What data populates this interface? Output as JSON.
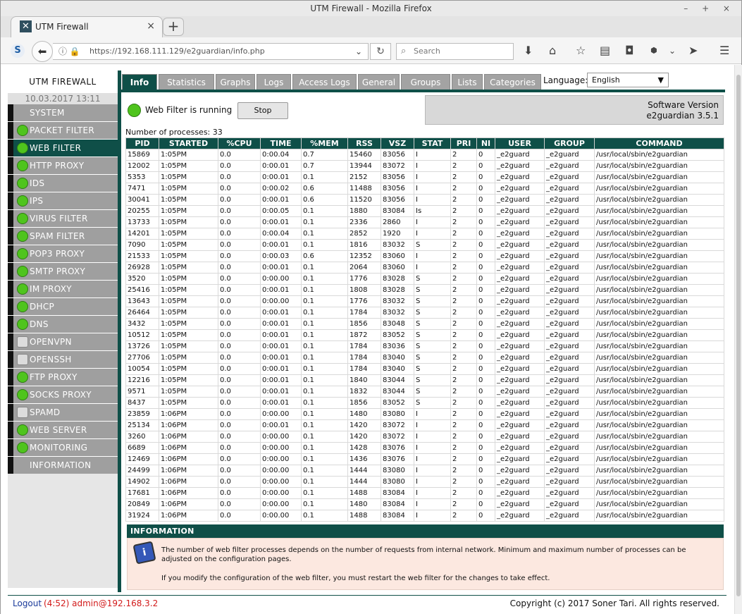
{
  "window": {
    "title": "UTM Firewall - Mozilla Firefox",
    "controls": "– + ×"
  },
  "tab": {
    "title": "UTM Firewall",
    "close": "×",
    "new_tab": "+"
  },
  "navbar": {
    "url": "https://192.168.111.129/e2guardian/info.php",
    "search_placeholder": "Search",
    "sync_badge": "S"
  },
  "sidebar": {
    "brand": "UTM FIREWALL",
    "datetime": "10.03.2017 13:11",
    "items": [
      {
        "label": "SYSTEM",
        "status": "none"
      },
      {
        "label": "PACKET FILTER",
        "status": "on"
      },
      {
        "label": "WEB FILTER",
        "status": "on",
        "active": true
      },
      {
        "label": "HTTP PROXY",
        "status": "on"
      },
      {
        "label": "IDS",
        "status": "on"
      },
      {
        "label": "IPS",
        "status": "on"
      },
      {
        "label": "VIRUS FILTER",
        "status": "on"
      },
      {
        "label": "SPAM FILTER",
        "status": "on"
      },
      {
        "label": "POP3 PROXY",
        "status": "on"
      },
      {
        "label": "SMTP PROXY",
        "status": "on"
      },
      {
        "label": "IM PROXY",
        "status": "on"
      },
      {
        "label": "DHCP",
        "status": "on"
      },
      {
        "label": "DNS",
        "status": "on"
      },
      {
        "label": "OPENVPN",
        "status": "off"
      },
      {
        "label": "OPENSSH",
        "status": "off"
      },
      {
        "label": "FTP PROXY",
        "status": "on"
      },
      {
        "label": "SOCKS PROXY",
        "status": "on"
      },
      {
        "label": "SPAMD",
        "status": "off"
      },
      {
        "label": "WEB SERVER",
        "status": "on"
      },
      {
        "label": "MONITORING",
        "status": "on"
      },
      {
        "label": "INFORMATION",
        "status": "none"
      }
    ]
  },
  "tabs": [
    {
      "label": "Info",
      "active": true
    },
    {
      "label": "Statistics"
    },
    {
      "label": "Graphs"
    },
    {
      "label": "Logs"
    },
    {
      "label": "Access Logs"
    },
    {
      "label": "General"
    },
    {
      "label": "Groups"
    },
    {
      "label": "Lists"
    },
    {
      "label": "Categories"
    }
  ],
  "language": {
    "label": "Language:",
    "selected": "English"
  },
  "status": {
    "text": "Web Filter is running",
    "stop_label": "Stop"
  },
  "software": {
    "title": "Software Version",
    "version": "e2guardian 3.5.1"
  },
  "processes": {
    "count_text": "Number of processes: 33",
    "columns": [
      "PID",
      "STARTED",
      "%CPU",
      "TIME",
      "%MEM",
      "RSS",
      "VSZ",
      "STAT",
      "PRI",
      "NI",
      "USER",
      "GROUP",
      "COMMAND"
    ],
    "rows": [
      [
        "15869",
        "1:05PM",
        "0.0",
        "0:00.04",
        "0.7",
        "15460",
        "83056",
        "I",
        "2",
        "0",
        "_e2guard",
        "_e2guard",
        "/usr/local/sbin/e2guardian"
      ],
      [
        "12002",
        "1:05PM",
        "0.0",
        "0:00.01",
        "0.7",
        "13944",
        "83072",
        "I",
        "2",
        "0",
        "_e2guard",
        "_e2guard",
        "/usr/local/sbin/e2guardian"
      ],
      [
        "5353",
        "1:05PM",
        "0.0",
        "0:00.01",
        "0.1",
        "2152",
        "83056",
        "I",
        "2",
        "0",
        "_e2guard",
        "_e2guard",
        "/usr/local/sbin/e2guardian"
      ],
      [
        "7471",
        "1:05PM",
        "0.0",
        "0:00.02",
        "0.6",
        "11488",
        "83056",
        "I",
        "2",
        "0",
        "_e2guard",
        "_e2guard",
        "/usr/local/sbin/e2guardian"
      ],
      [
        "30041",
        "1:05PM",
        "0.0",
        "0:00.01",
        "0.6",
        "11520",
        "83056",
        "I",
        "2",
        "0",
        "_e2guard",
        "_e2guard",
        "/usr/local/sbin/e2guardian"
      ],
      [
        "20255",
        "1:05PM",
        "0.0",
        "0:00.05",
        "0.1",
        "1880",
        "83084",
        "Is",
        "2",
        "0",
        "_e2guard",
        "_e2guard",
        "/usr/local/sbin/e2guardian"
      ],
      [
        "13733",
        "1:05PM",
        "0.0",
        "0:00.01",
        "0.1",
        "2336",
        "2860",
        "I",
        "2",
        "0",
        "_e2guard",
        "_e2guard",
        "/usr/local/sbin/e2guardian"
      ],
      [
        "14201",
        "1:05PM",
        "0.0",
        "0:00.04",
        "0.1",
        "2852",
        "1920",
        "I",
        "2",
        "0",
        "_e2guard",
        "_e2guard",
        "/usr/local/sbin/e2guardian"
      ],
      [
        "7090",
        "1:05PM",
        "0.0",
        "0:00.01",
        "0.1",
        "1816",
        "83032",
        "S",
        "2",
        "0",
        "_e2guard",
        "_e2guard",
        "/usr/local/sbin/e2guardian"
      ],
      [
        "21533",
        "1:05PM",
        "0.0",
        "0:00.03",
        "0.6",
        "12352",
        "83060",
        "I",
        "2",
        "0",
        "_e2guard",
        "_e2guard",
        "/usr/local/sbin/e2guardian"
      ],
      [
        "26928",
        "1:05PM",
        "0.0",
        "0:00.01",
        "0.1",
        "2064",
        "83060",
        "I",
        "2",
        "0",
        "_e2guard",
        "_e2guard",
        "/usr/local/sbin/e2guardian"
      ],
      [
        "3520",
        "1:05PM",
        "0.0",
        "0:00.00",
        "0.1",
        "1776",
        "83028",
        "S",
        "2",
        "0",
        "_e2guard",
        "_e2guard",
        "/usr/local/sbin/e2guardian"
      ],
      [
        "25416",
        "1:05PM",
        "0.0",
        "0:00.01",
        "0.1",
        "1808",
        "83028",
        "S",
        "2",
        "0",
        "_e2guard",
        "_e2guard",
        "/usr/local/sbin/e2guardian"
      ],
      [
        "13643",
        "1:05PM",
        "0.0",
        "0:00.00",
        "0.1",
        "1776",
        "83032",
        "S",
        "2",
        "0",
        "_e2guard",
        "_e2guard",
        "/usr/local/sbin/e2guardian"
      ],
      [
        "26464",
        "1:05PM",
        "0.0",
        "0:00.01",
        "0.1",
        "1784",
        "83032",
        "S",
        "2",
        "0",
        "_e2guard",
        "_e2guard",
        "/usr/local/sbin/e2guardian"
      ],
      [
        "3432",
        "1:05PM",
        "0.0",
        "0:00.01",
        "0.1",
        "1856",
        "83048",
        "S",
        "2",
        "0",
        "_e2guard",
        "_e2guard",
        "/usr/local/sbin/e2guardian"
      ],
      [
        "10512",
        "1:05PM",
        "0.0",
        "0:00.01",
        "0.1",
        "1872",
        "83052",
        "S",
        "2",
        "0",
        "_e2guard",
        "_e2guard",
        "/usr/local/sbin/e2guardian"
      ],
      [
        "13726",
        "1:05PM",
        "0.0",
        "0:00.01",
        "0.1",
        "1784",
        "83036",
        "S",
        "2",
        "0",
        "_e2guard",
        "_e2guard",
        "/usr/local/sbin/e2guardian"
      ],
      [
        "27706",
        "1:05PM",
        "0.0",
        "0:00.01",
        "0.1",
        "1784",
        "83040",
        "S",
        "2",
        "0",
        "_e2guard",
        "_e2guard",
        "/usr/local/sbin/e2guardian"
      ],
      [
        "10054",
        "1:05PM",
        "0.0",
        "0:00.01",
        "0.1",
        "1784",
        "83040",
        "S",
        "2",
        "0",
        "_e2guard",
        "_e2guard",
        "/usr/local/sbin/e2guardian"
      ],
      [
        "12216",
        "1:05PM",
        "0.0",
        "0:00.01",
        "0.1",
        "1840",
        "83044",
        "S",
        "2",
        "0",
        "_e2guard",
        "_e2guard",
        "/usr/local/sbin/e2guardian"
      ],
      [
        "9571",
        "1:05PM",
        "0.0",
        "0:00.01",
        "0.1",
        "1832",
        "83044",
        "S",
        "2",
        "0",
        "_e2guard",
        "_e2guard",
        "/usr/local/sbin/e2guardian"
      ],
      [
        "8437",
        "1:05PM",
        "0.0",
        "0:00.01",
        "0.1",
        "1856",
        "83052",
        "S",
        "2",
        "0",
        "_e2guard",
        "_e2guard",
        "/usr/local/sbin/e2guardian"
      ],
      [
        "23859",
        "1:06PM",
        "0.0",
        "0:00.00",
        "0.1",
        "1480",
        "83080",
        "I",
        "2",
        "0",
        "_e2guard",
        "_e2guard",
        "/usr/local/sbin/e2guardian"
      ],
      [
        "25134",
        "1:06PM",
        "0.0",
        "0:00.01",
        "0.1",
        "1420",
        "83072",
        "I",
        "2",
        "0",
        "_e2guard",
        "_e2guard",
        "/usr/local/sbin/e2guardian"
      ],
      [
        "3260",
        "1:06PM",
        "0.0",
        "0:00.00",
        "0.1",
        "1420",
        "83072",
        "I",
        "2",
        "0",
        "_e2guard",
        "_e2guard",
        "/usr/local/sbin/e2guardian"
      ],
      [
        "6689",
        "1:06PM",
        "0.0",
        "0:00.00",
        "0.1",
        "1428",
        "83076",
        "I",
        "2",
        "0",
        "_e2guard",
        "_e2guard",
        "/usr/local/sbin/e2guardian"
      ],
      [
        "12469",
        "1:06PM",
        "0.0",
        "0:00.00",
        "0.1",
        "1436",
        "83076",
        "I",
        "2",
        "0",
        "_e2guard",
        "_e2guard",
        "/usr/local/sbin/e2guardian"
      ],
      [
        "24499",
        "1:06PM",
        "0.0",
        "0:00.00",
        "0.1",
        "1444",
        "83080",
        "I",
        "2",
        "0",
        "_e2guard",
        "_e2guard",
        "/usr/local/sbin/e2guardian"
      ],
      [
        "14902",
        "1:06PM",
        "0.0",
        "0:00.00",
        "0.1",
        "1444",
        "83080",
        "I",
        "2",
        "0",
        "_e2guard",
        "_e2guard",
        "/usr/local/sbin/e2guardian"
      ],
      [
        "17681",
        "1:06PM",
        "0.0",
        "0:00.00",
        "0.1",
        "1488",
        "83084",
        "I",
        "2",
        "0",
        "_e2guard",
        "_e2guard",
        "/usr/local/sbin/e2guardian"
      ],
      [
        "20849",
        "1:06PM",
        "0.0",
        "0:00.00",
        "0.1",
        "1480",
        "83084",
        "I",
        "2",
        "0",
        "_e2guard",
        "_e2guard",
        "/usr/local/sbin/e2guardian"
      ],
      [
        "31924",
        "1:06PM",
        "0.0",
        "0:00.00",
        "0.1",
        "1488",
        "83084",
        "I",
        "2",
        "0",
        "_e2guard",
        "_e2guard",
        "/usr/local/sbin/e2guardian"
      ]
    ]
  },
  "information": {
    "title": "INFORMATION",
    "p1": "The number of web filter processes depends on the number of requests from internal network. Minimum and maximum number of processes can be adjusted on the configuration pages.",
    "p2": "If you modify the configuration of the web filter, you must restart the web filter for the changes to take effect."
  },
  "footer": {
    "logout": "Logout",
    "session": "(4:52) admin@192.168.3.2",
    "copyright": "Copyright (c) 2017 Soner Tari. All rights reserved."
  }
}
